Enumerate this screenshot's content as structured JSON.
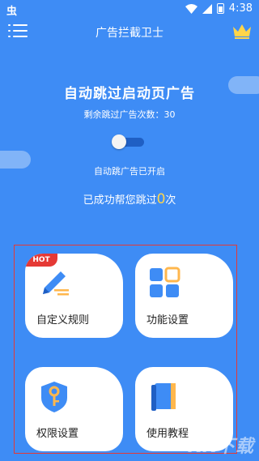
{
  "status_bar": {
    "left_text": "虫",
    "time": "4:38"
  },
  "app_bar": {
    "title": "广告拦截卫士"
  },
  "main": {
    "headline": "自动跳过启动页广告",
    "counter_label": "剩余跳过广告次数：30",
    "toggle_on": false,
    "status_text": "自动跳广告已开启",
    "skipped_prefix": "已成功帮您跳过",
    "skipped_count": "0",
    "skipped_suffix": "次"
  },
  "cards": [
    {
      "label": "自定义规则",
      "icon": "pencil-icon",
      "badge": "HOT"
    },
    {
      "label": "功能设置",
      "icon": "grid-icon"
    },
    {
      "label": "权限设置",
      "icon": "shield-key-icon"
    },
    {
      "label": "使用教程",
      "icon": "book-icon"
    }
  ],
  "watermark": "KK下载",
  "colors": {
    "background": "#3e8cf5",
    "accent": "#ffd54a",
    "hot": "#e53935",
    "icon_blue": "#3e8cf5"
  }
}
